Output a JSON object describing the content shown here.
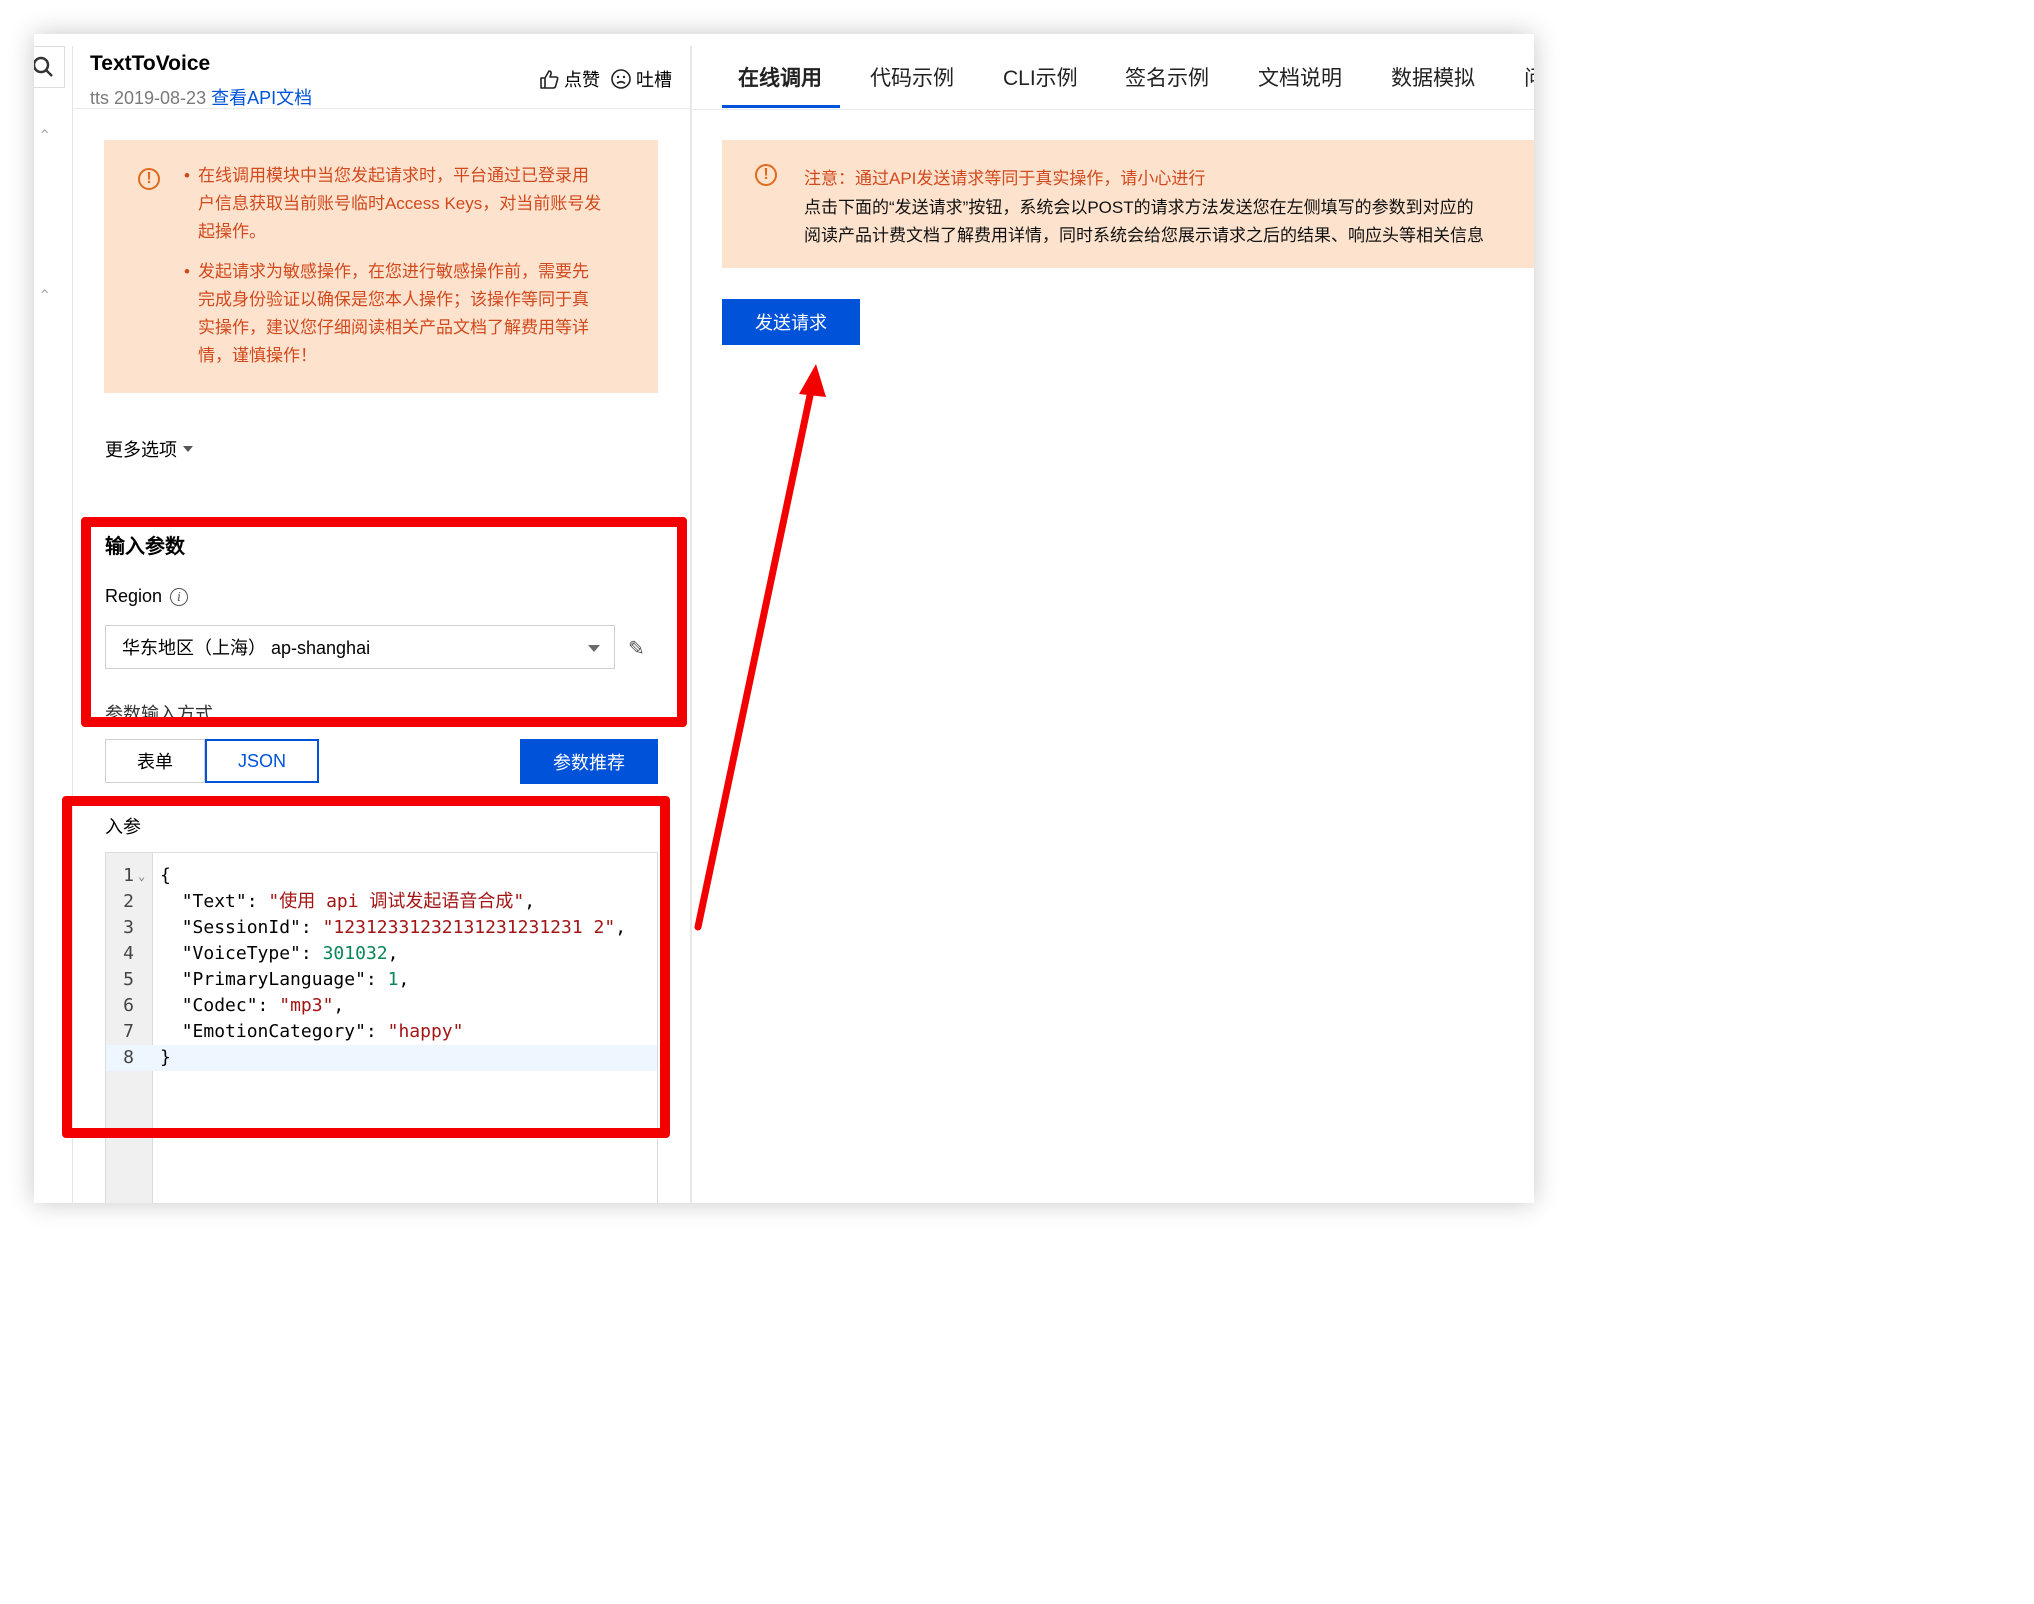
{
  "header": {
    "title": "TextToVoice",
    "meta": "tts 2019-08-23",
    "doc_link": "查看API文档",
    "like_label": "点赞",
    "rant_label": "吐槽"
  },
  "left_notice": {
    "items": [
      "在线调用模块中当您发起请求时，平台通过已登录用户信息获取当前账号临时Access Keys，对当前账号发起操作。",
      "发起请求为敏感操作，在您进行敏感操作前，需要先完成身份验证以确保是您本人操作；该操作等同于真实操作，建议您仔细阅读相关产品文档了解费用等详情，谨慎操作！"
    ]
  },
  "more_options": "更多选项",
  "input_params": {
    "title": "输入参数",
    "region_label": "Region",
    "region_value": "华东地区（上海） ap-shanghai",
    "mode_label": "参数输入方式",
    "modes": [
      "表单",
      "JSON"
    ],
    "active_mode": "JSON",
    "recommend_button": "参数推荐",
    "input_label": "入参"
  },
  "code": {
    "lines": [
      {
        "n": "1",
        "text": "{"
      },
      {
        "n": "2",
        "key": "\"Text\"",
        "val": "\"使用 api 调试发起语音合成\"",
        "type": "s",
        "comma": ","
      },
      {
        "n": "3",
        "key": "\"SessionId\"",
        "val": "\"12312331232131231231231 2\"",
        "type": "s",
        "comma": ","
      },
      {
        "n": "4",
        "key": "\"VoiceType\"",
        "val": "301032",
        "type": "n",
        "comma": ","
      },
      {
        "n": "5",
        "key": "\"PrimaryLanguage\"",
        "val": "1",
        "type": "n",
        "comma": ","
      },
      {
        "n": "6",
        "key": "\"Codec\"",
        "val": "\"mp3\"",
        "type": "s",
        "comma": ","
      },
      {
        "n": "7",
        "key": "\"EmotionCategory\"",
        "val": "\"happy\"",
        "type": "s",
        "comma": ""
      },
      {
        "n": "8",
        "text": "}"
      }
    ]
  },
  "tabs": [
    "在线调用",
    "代码示例",
    "CLI示例",
    "签名示例",
    "文档说明",
    "数据模拟",
    "问"
  ],
  "active_tab": "在线调用",
  "right_notice": {
    "line1": "注意：通过API发送请求等同于真实操作，请小心进行",
    "line2": "点击下面的“发送请求”按钮，系统会以POST的请求方法发送您在左侧填写的参数到对应的",
    "line3": "阅读产品计费文档了解费用详情，同时系统会给您展示请求之后的结果、响应头等相关信息"
  },
  "send_button": "发送请求",
  "colors": {
    "primary": "#0052d9",
    "notice_bg": "#fde3cd",
    "notice_text": "#d14a1f",
    "annotation_red": "#f30000"
  }
}
